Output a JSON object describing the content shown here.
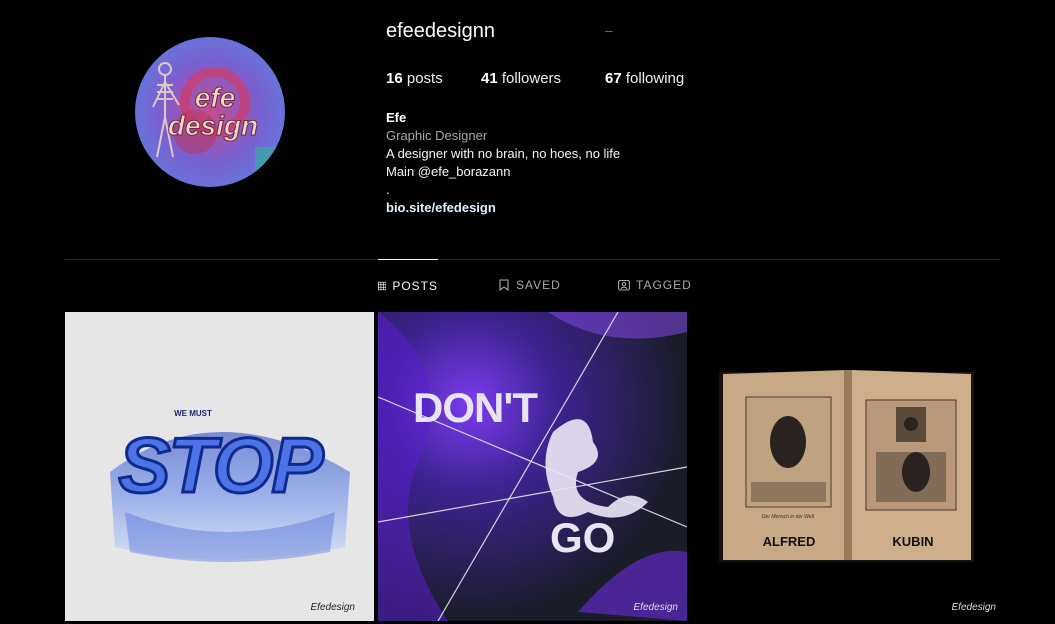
{
  "profile": {
    "username": "efeedesignn",
    "dash": "–",
    "avatar_text_1": "efe",
    "avatar_text_2": "design"
  },
  "stats": {
    "posts_count": "16",
    "posts_label": "posts",
    "followers_count": "41",
    "followers_label": "followers",
    "following_count": "67",
    "following_label": "following"
  },
  "bio": {
    "name": "Efe",
    "category": "Graphic Designer",
    "line1": "A designer with no brain, no hoes, no life",
    "line2": "Main @efe_borazann",
    "line3": ".",
    "link": "bio.site/efedesign"
  },
  "tabs": [
    {
      "label": "POSTS",
      "icon": "grid-icon",
      "active": true
    },
    {
      "label": "SAVED",
      "icon": "bookmark-icon",
      "active": false
    },
    {
      "label": "TAGGED",
      "icon": "tag-icon",
      "active": false
    }
  ],
  "posts": [
    {
      "title": "STOP",
      "small": "WE MUST",
      "signature": "Efedesign",
      "bg": "#e6e6e6"
    },
    {
      "title_top": "DON'T",
      "title_bottom": "GO",
      "signature": "Efedesign",
      "bg": "#1a1c28"
    },
    {
      "left_caption": "ALFRED",
      "right_caption": "KUBIN",
      "inscription": "Der Mensch in der Welt",
      "signature": "Efedesign",
      "bg": "#000000"
    }
  ],
  "colors": {
    "background": "#000000",
    "text": "#f5f5f5",
    "muted": "#a8a8a8",
    "divider": "#262626",
    "link": "#e0f1ff"
  }
}
